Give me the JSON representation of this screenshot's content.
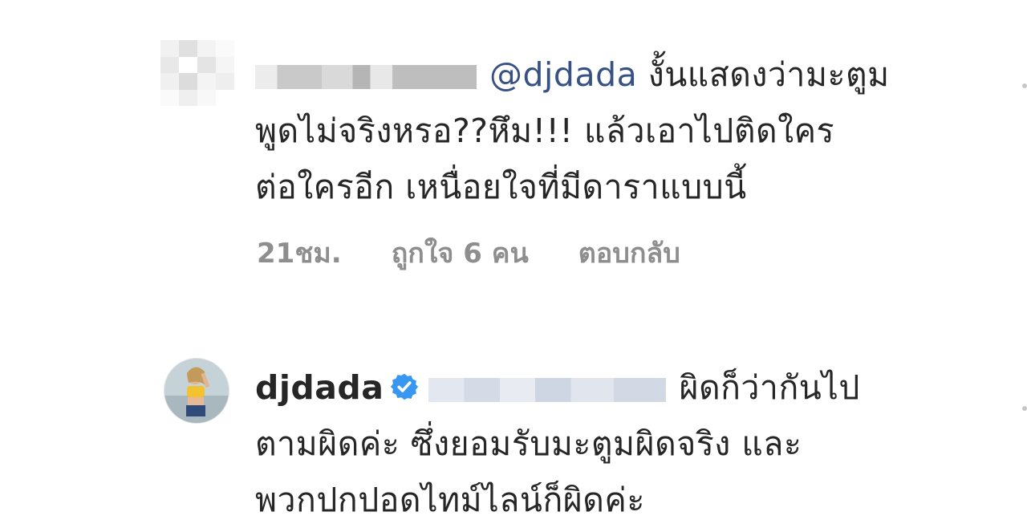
{
  "comment1": {
    "mention": "@djdada",
    "text_line1": " งั้นแสดงว่ามะตูม",
    "text_line2": "พูดไม่จริงหรอ??หึม!!! แล้วเอาไปติดใคร",
    "text_line3": "ต่อใครอีก เหนื่อยใจที่มีดาราแบบนี้",
    "time": "21ชม.",
    "likes": "ถูกใจ 6 คน",
    "reply": "ตอบกลับ"
  },
  "comment2": {
    "username": "djdada",
    "text_line1": "ผิดก็ว่ากันไป",
    "text_line2": "ตามผิดค่ะ ซึ่งยอมรับมะตูมผิดจริง และ",
    "text_line3": "พวกปกปอดไทม์ไลน์ก็ผิดค่ะ"
  },
  "icons": {
    "verified": "verified-badge-icon",
    "avatar": "profile-avatar"
  },
  "colors": {
    "mention": "#385185",
    "meta": "#8e8e8e",
    "verified": "#3897f0"
  }
}
